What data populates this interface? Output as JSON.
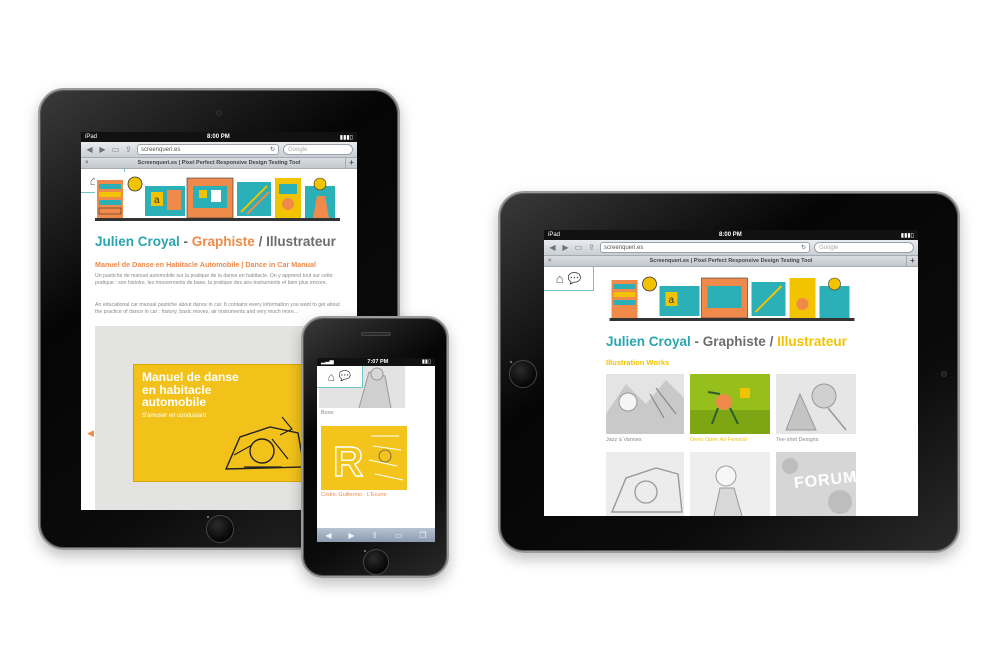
{
  "colors": {
    "teal": "#29a5b0",
    "orange": "#f08a4b",
    "yellow": "#f2c300",
    "gray": "#6d6d6d"
  },
  "browser": {
    "carrier": "iPad",
    "time": "8:00 PM",
    "url": "screenqueri.es",
    "search_placeholder": "Google",
    "page_title": "Screenqueri.es | Pixel Perfect Responsive Design Testing Tool",
    "icons": [
      "back-icon",
      "forward-icon",
      "bookmarks-icon",
      "share-icon",
      "reload-icon",
      "new-tab-icon"
    ]
  },
  "site": {
    "nav_icons": [
      "home-icon",
      "comments-icon"
    ],
    "name": "Julien Croyal",
    "separator1": " - ",
    "role1": "Graphiste",
    "separator2": " / ",
    "role2": "Illustrateur"
  },
  "ipad_portrait": {
    "project_title": "Manuel de Danse en Habitacle Automobile | Dance in Car Manual",
    "paragraph_fr": "Un pastiche de manuel automobile sur la pratique de la danse en habitacle. On y apprend tout sur cette pratique : son histoire, les mouvements de base, la pratique des airs-instruments et bien plus encore.",
    "paragraph_en": "An educational car manual pastiche about dance in car. It contains every information you want to get about the practice of dance in car : history, basic moves, air instruments and very much more...",
    "cover_title": "Manuel de danse en habitacle automobile",
    "cover_subtitle": "S'amuser en conduisant",
    "prev_arrow": "◀"
  },
  "iphone": {
    "time": "7:07 PM",
    "item1_caption": "Boxe",
    "item2_caption": "Cédric Guillermo - L'Écurie",
    "bottom_icons": [
      "back-icon",
      "forward-icon",
      "share-icon",
      "bookmarks-icon",
      "pages-icon"
    ]
  },
  "ipad_landscape": {
    "section_title": "Illustration Works",
    "thumbs": [
      {
        "caption": "Jazz à Vannes",
        "highlight": false
      },
      {
        "caption": "Oeno Open Air Festival",
        "highlight": true
      },
      {
        "caption": "Tee-shirt Designs",
        "highlight": false
      },
      {
        "caption": "",
        "highlight": false
      },
      {
        "caption": "",
        "highlight": false
      },
      {
        "caption": "FORUM",
        "highlight": false
      }
    ]
  }
}
